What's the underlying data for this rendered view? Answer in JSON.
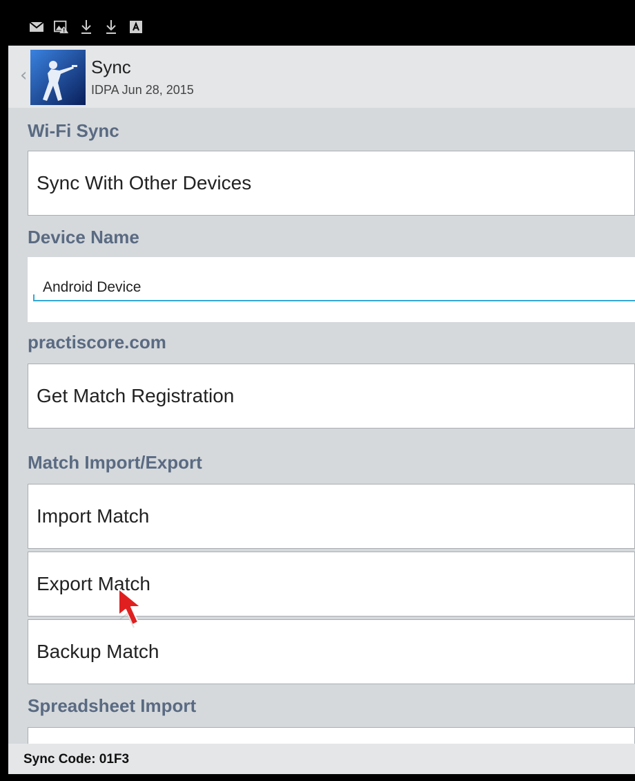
{
  "status_bar": {
    "icons": [
      "mail-icon",
      "image-warning-icon",
      "download-icon",
      "download-icon",
      "keyboard-a-icon"
    ]
  },
  "action_bar": {
    "title": "Sync",
    "subtitle": "IDPA Jun 28, 2015",
    "back_icon": "chevron-left-icon",
    "logo": "app-logo"
  },
  "sections": {
    "wifi": {
      "header": "Wi-Fi Sync",
      "item": "Sync With Other Devices"
    },
    "device": {
      "header": "Device Name",
      "input_value": "Android Device"
    },
    "practiscore": {
      "header": "practiscore.com",
      "item": "Get Match Registration"
    },
    "import_export": {
      "header": "Match Import/Export",
      "items": [
        "Import Match",
        "Export Match",
        "Backup Match"
      ]
    },
    "spreadsheet": {
      "header": "Spreadsheet Import"
    }
  },
  "footer": {
    "sync_code": "Sync Code: 01F3"
  },
  "colors": {
    "section_header": "#5a6a82",
    "input_underline": "#33a7d6",
    "background": "#d5d9dc",
    "cursor": "#e02020"
  }
}
